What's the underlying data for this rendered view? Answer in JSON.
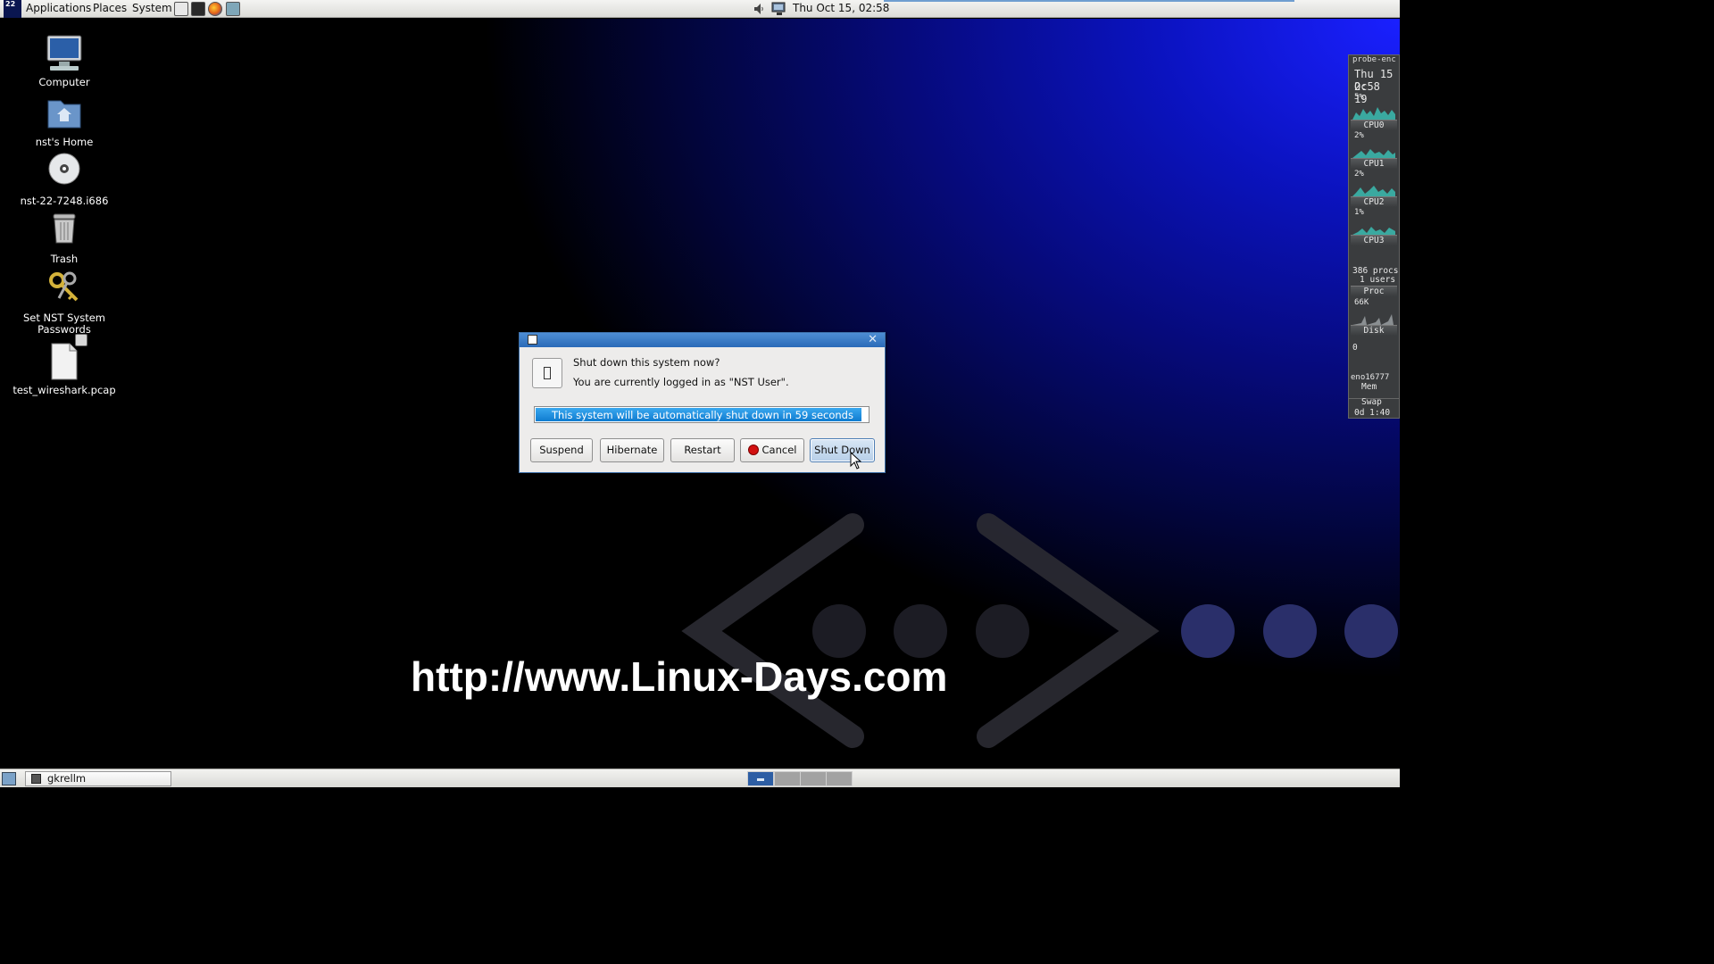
{
  "top_panel": {
    "distro_badge": "22",
    "menus": [
      "Applications",
      "Places",
      "System"
    ],
    "launchers": [
      "document-editor-icon",
      "terminal-icon",
      "firefox-icon",
      "network-tool-icon"
    ],
    "clock": "Thu Oct 15, 02:58"
  },
  "desktop": {
    "icons": [
      {
        "label": "Computer",
        "icon": "computer-icon"
      },
      {
        "label": "nst's Home",
        "icon": "home-folder-icon"
      },
      {
        "label": "nst-22-7248.i686",
        "icon": "disc-icon"
      },
      {
        "label": "Trash",
        "icon": "trash-icon"
      },
      {
        "label": "Set NST System Passwords",
        "icon": "keys-icon"
      },
      {
        "label": "test_wireshark.pcap",
        "icon": "file-icon"
      }
    ],
    "wallpaper_text": "http://www.Linux-Days.com"
  },
  "gkrellm": {
    "host": "probe-enc",
    "date": "Thu 15 Oc",
    "time": "2:58 19",
    "cpus": [
      {
        "name": "CPU0",
        "percent": "5%"
      },
      {
        "name": "CPU1",
        "percent": "2%"
      },
      {
        "name": "CPU2",
        "percent": "2%"
      },
      {
        "name": "CPU3",
        "percent": "1%"
      }
    ],
    "procs": "386 procs",
    "users": "1 users",
    "proc_label": "Proc",
    "disk_value": "66K",
    "disk_label": "Disk",
    "net_value": "0",
    "net_label": "eno16777",
    "mem_label": "Mem",
    "swap_label": "Swap",
    "uptime": "0d 1:40"
  },
  "dialog": {
    "heading": "Shut down this system now?",
    "message": "You are currently logged in as \"NST User\".",
    "countdown_text": "This system will be automatically shut down in 59 seconds",
    "countdown_progress": 0.98,
    "buttons": {
      "suspend": "Suspend",
      "hibernate": "Hibernate",
      "restart": "Restart",
      "cancel": "Cancel",
      "shutdown": "Shut Down"
    }
  },
  "bottom_panel": {
    "task": "gkrellm",
    "workspaces": 4,
    "active_workspace": 1
  }
}
